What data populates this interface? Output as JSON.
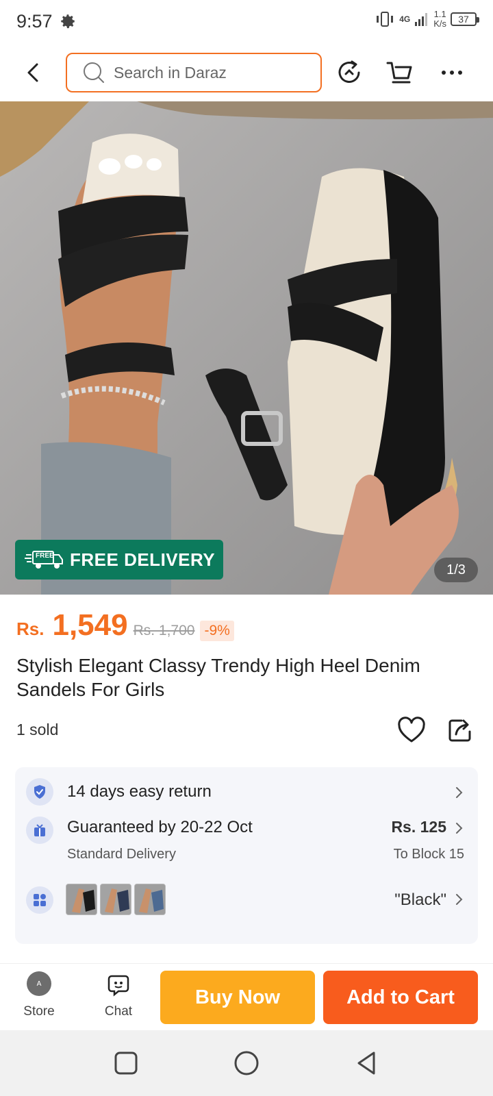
{
  "status_bar": {
    "time": "9:57",
    "network": "4G",
    "speed_value": "1.1",
    "speed_unit": "K/s",
    "battery": "37"
  },
  "top_nav": {
    "search_placeholder": "Search in Daraz",
    "accent_color": "#f36f21"
  },
  "hero": {
    "badge_label": "FREE DELIVERY",
    "badge_icon_text": "FREE",
    "pager": "1/3"
  },
  "product": {
    "currency": "Rs.",
    "price": "1,549",
    "old_price": "Rs. 1,700",
    "discount": "-9%",
    "title": "Stylish Elegant Classy Trendy High Heel Denim Sandels For Girls",
    "sold": "1 sold"
  },
  "info": {
    "return_text": "14 days easy return",
    "delivery_text": "Guaranteed by 20-22 Oct",
    "delivery_sub": "Standard Delivery",
    "delivery_fee": "Rs. 125",
    "delivery_location": "To Block 15",
    "variant_value": "\"Black\""
  },
  "action_bar": {
    "store_label": "Store",
    "chat_label": "Chat",
    "buy_now": "Buy Now",
    "add_to_cart": "Add to Cart"
  }
}
